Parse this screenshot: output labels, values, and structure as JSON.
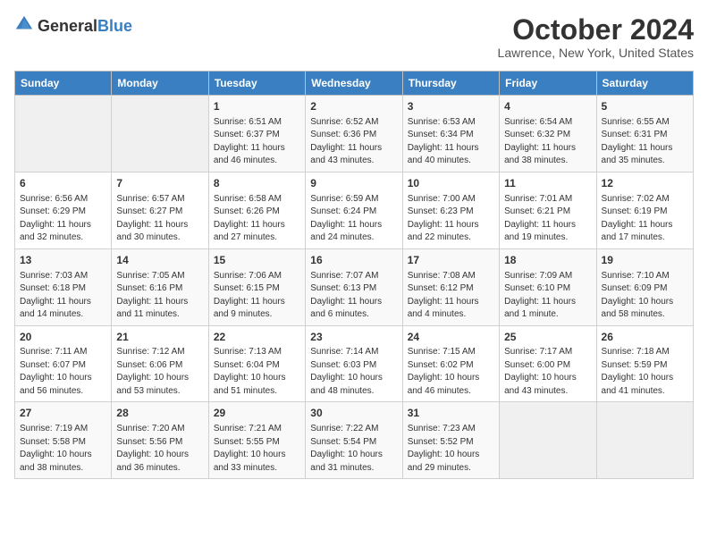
{
  "header": {
    "logo_general": "General",
    "logo_blue": "Blue",
    "month_title": "October 2024",
    "location": "Lawrence, New York, United States"
  },
  "weekdays": [
    "Sunday",
    "Monday",
    "Tuesday",
    "Wednesday",
    "Thursday",
    "Friday",
    "Saturday"
  ],
  "weeks": [
    [
      {
        "day": "",
        "info": ""
      },
      {
        "day": "",
        "info": ""
      },
      {
        "day": "1",
        "sunrise": "Sunrise: 6:51 AM",
        "sunset": "Sunset: 6:37 PM",
        "daylight": "Daylight: 11 hours and 46 minutes."
      },
      {
        "day": "2",
        "sunrise": "Sunrise: 6:52 AM",
        "sunset": "Sunset: 6:36 PM",
        "daylight": "Daylight: 11 hours and 43 minutes."
      },
      {
        "day": "3",
        "sunrise": "Sunrise: 6:53 AM",
        "sunset": "Sunset: 6:34 PM",
        "daylight": "Daylight: 11 hours and 40 minutes."
      },
      {
        "day": "4",
        "sunrise": "Sunrise: 6:54 AM",
        "sunset": "Sunset: 6:32 PM",
        "daylight": "Daylight: 11 hours and 38 minutes."
      },
      {
        "day": "5",
        "sunrise": "Sunrise: 6:55 AM",
        "sunset": "Sunset: 6:31 PM",
        "daylight": "Daylight: 11 hours and 35 minutes."
      }
    ],
    [
      {
        "day": "6",
        "sunrise": "Sunrise: 6:56 AM",
        "sunset": "Sunset: 6:29 PM",
        "daylight": "Daylight: 11 hours and 32 minutes."
      },
      {
        "day": "7",
        "sunrise": "Sunrise: 6:57 AM",
        "sunset": "Sunset: 6:27 PM",
        "daylight": "Daylight: 11 hours and 30 minutes."
      },
      {
        "day": "8",
        "sunrise": "Sunrise: 6:58 AM",
        "sunset": "Sunset: 6:26 PM",
        "daylight": "Daylight: 11 hours and 27 minutes."
      },
      {
        "day": "9",
        "sunrise": "Sunrise: 6:59 AM",
        "sunset": "Sunset: 6:24 PM",
        "daylight": "Daylight: 11 hours and 24 minutes."
      },
      {
        "day": "10",
        "sunrise": "Sunrise: 7:00 AM",
        "sunset": "Sunset: 6:23 PM",
        "daylight": "Daylight: 11 hours and 22 minutes."
      },
      {
        "day": "11",
        "sunrise": "Sunrise: 7:01 AM",
        "sunset": "Sunset: 6:21 PM",
        "daylight": "Daylight: 11 hours and 19 minutes."
      },
      {
        "day": "12",
        "sunrise": "Sunrise: 7:02 AM",
        "sunset": "Sunset: 6:19 PM",
        "daylight": "Daylight: 11 hours and 17 minutes."
      }
    ],
    [
      {
        "day": "13",
        "sunrise": "Sunrise: 7:03 AM",
        "sunset": "Sunset: 6:18 PM",
        "daylight": "Daylight: 11 hours and 14 minutes."
      },
      {
        "day": "14",
        "sunrise": "Sunrise: 7:05 AM",
        "sunset": "Sunset: 6:16 PM",
        "daylight": "Daylight: 11 hours and 11 minutes."
      },
      {
        "day": "15",
        "sunrise": "Sunrise: 7:06 AM",
        "sunset": "Sunset: 6:15 PM",
        "daylight": "Daylight: 11 hours and 9 minutes."
      },
      {
        "day": "16",
        "sunrise": "Sunrise: 7:07 AM",
        "sunset": "Sunset: 6:13 PM",
        "daylight": "Daylight: 11 hours and 6 minutes."
      },
      {
        "day": "17",
        "sunrise": "Sunrise: 7:08 AM",
        "sunset": "Sunset: 6:12 PM",
        "daylight": "Daylight: 11 hours and 4 minutes."
      },
      {
        "day": "18",
        "sunrise": "Sunrise: 7:09 AM",
        "sunset": "Sunset: 6:10 PM",
        "daylight": "Daylight: 11 hours and 1 minute."
      },
      {
        "day": "19",
        "sunrise": "Sunrise: 7:10 AM",
        "sunset": "Sunset: 6:09 PM",
        "daylight": "Daylight: 10 hours and 58 minutes."
      }
    ],
    [
      {
        "day": "20",
        "sunrise": "Sunrise: 7:11 AM",
        "sunset": "Sunset: 6:07 PM",
        "daylight": "Daylight: 10 hours and 56 minutes."
      },
      {
        "day": "21",
        "sunrise": "Sunrise: 7:12 AM",
        "sunset": "Sunset: 6:06 PM",
        "daylight": "Daylight: 10 hours and 53 minutes."
      },
      {
        "day": "22",
        "sunrise": "Sunrise: 7:13 AM",
        "sunset": "Sunset: 6:04 PM",
        "daylight": "Daylight: 10 hours and 51 minutes."
      },
      {
        "day": "23",
        "sunrise": "Sunrise: 7:14 AM",
        "sunset": "Sunset: 6:03 PM",
        "daylight": "Daylight: 10 hours and 48 minutes."
      },
      {
        "day": "24",
        "sunrise": "Sunrise: 7:15 AM",
        "sunset": "Sunset: 6:02 PM",
        "daylight": "Daylight: 10 hours and 46 minutes."
      },
      {
        "day": "25",
        "sunrise": "Sunrise: 7:17 AM",
        "sunset": "Sunset: 6:00 PM",
        "daylight": "Daylight: 10 hours and 43 minutes."
      },
      {
        "day": "26",
        "sunrise": "Sunrise: 7:18 AM",
        "sunset": "Sunset: 5:59 PM",
        "daylight": "Daylight: 10 hours and 41 minutes."
      }
    ],
    [
      {
        "day": "27",
        "sunrise": "Sunrise: 7:19 AM",
        "sunset": "Sunset: 5:58 PM",
        "daylight": "Daylight: 10 hours and 38 minutes."
      },
      {
        "day": "28",
        "sunrise": "Sunrise: 7:20 AM",
        "sunset": "Sunset: 5:56 PM",
        "daylight": "Daylight: 10 hours and 36 minutes."
      },
      {
        "day": "29",
        "sunrise": "Sunrise: 7:21 AM",
        "sunset": "Sunset: 5:55 PM",
        "daylight": "Daylight: 10 hours and 33 minutes."
      },
      {
        "day": "30",
        "sunrise": "Sunrise: 7:22 AM",
        "sunset": "Sunset: 5:54 PM",
        "daylight": "Daylight: 10 hours and 31 minutes."
      },
      {
        "day": "31",
        "sunrise": "Sunrise: 7:23 AM",
        "sunset": "Sunset: 5:52 PM",
        "daylight": "Daylight: 10 hours and 29 minutes."
      },
      {
        "day": "",
        "info": ""
      },
      {
        "day": "",
        "info": ""
      }
    ]
  ]
}
